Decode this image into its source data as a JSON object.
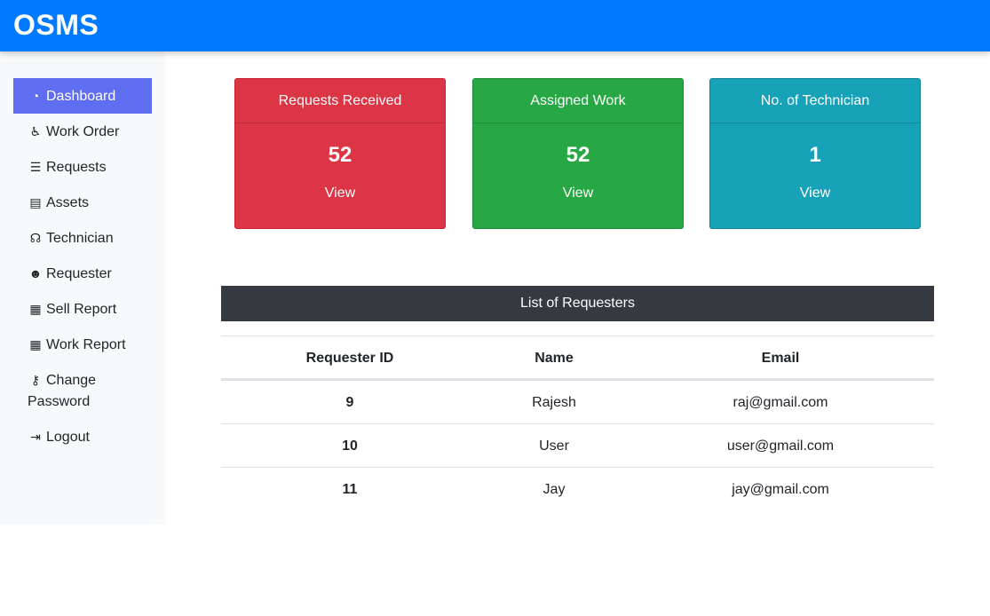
{
  "header": {
    "brand": "OSMS"
  },
  "sidebar": {
    "items": [
      {
        "label": "Dashboard",
        "icon": "tachometer-icon",
        "active": true
      },
      {
        "label": "Work Order",
        "icon": "accessible-icon"
      },
      {
        "label": "Requests",
        "icon": "align-center-icon"
      },
      {
        "label": "Assets",
        "icon": "database-icon"
      },
      {
        "label": "Technician",
        "icon": "headset-icon"
      },
      {
        "label": "Requester",
        "icon": "users-icon"
      },
      {
        "label": "Sell Report",
        "icon": "table-icon"
      },
      {
        "label": "Work Report",
        "icon": "table-icon"
      },
      {
        "label": "Change",
        "label2": "Password",
        "icon": "key-icon"
      },
      {
        "label": "Logout",
        "icon": "sign-out-icon"
      }
    ]
  },
  "cards": [
    {
      "title": "Requests Received",
      "count": "52",
      "link": "View",
      "color": "#dc3545"
    },
    {
      "title": "Assigned Work",
      "count": "52",
      "link": "View",
      "color": "#28a745"
    },
    {
      "title": "No. of Technician",
      "count": "1",
      "link": "View",
      "color": "#17a2b8"
    }
  ],
  "requesters": {
    "title": "List of Requesters",
    "columns": [
      "Requester ID",
      "Name",
      "Email"
    ],
    "rows": [
      {
        "id": "9",
        "name": "Rajesh",
        "email": "raj@gmail.com"
      },
      {
        "id": "10",
        "name": "User",
        "email": "user@gmail.com"
      },
      {
        "id": "11",
        "name": "Jay",
        "email": "jay@gmail.com"
      }
    ]
  },
  "colors": {
    "navbar": "#007bff",
    "active_nav": "#5f6df0",
    "table_header": "#343a40"
  }
}
